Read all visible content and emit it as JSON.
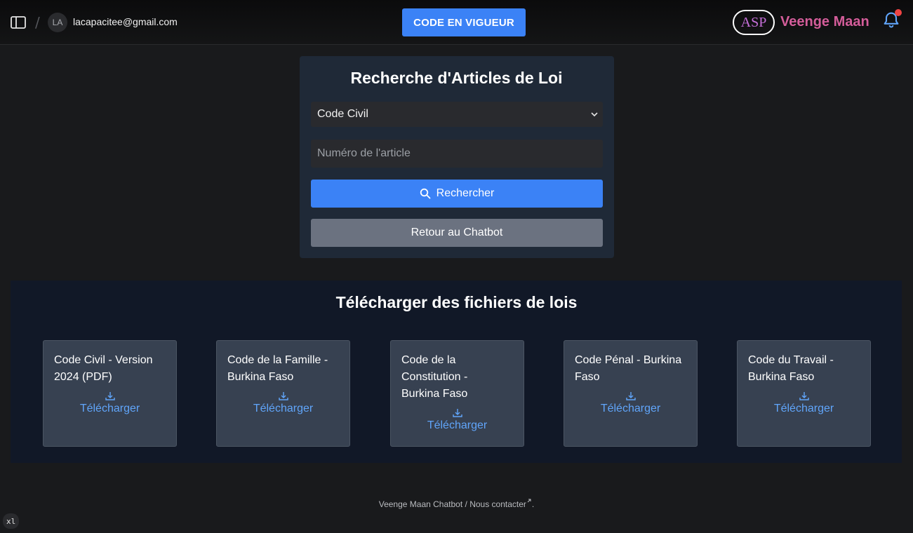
{
  "header": {
    "avatar_initials": "LA",
    "user_email": "lacapacitee@gmail.com",
    "code_button": "CODE EN VIGUEUR",
    "logo_text": "ASP",
    "brand_name": "Veenge Maan"
  },
  "search": {
    "title": "Recherche d'Articles de Loi",
    "selected_code": "Code Civil",
    "article_placeholder": "Numéro de l'article",
    "search_button": "Rechercher",
    "back_button": "Retour au Chatbot"
  },
  "downloads": {
    "title": "Télécharger des fichiers de lois",
    "files": [
      {
        "title": "Code Civil - Version 2024 (PDF)",
        "action": "Télécharger"
      },
      {
        "title": "Code de la Famille - Burkina Faso",
        "action": "Télécharger"
      },
      {
        "title": "Code de la Constitution - Burkina Faso",
        "action": "Télécharger"
      },
      {
        "title": "Code Pénal - Burkina Faso",
        "action": "Télécharger"
      },
      {
        "title": "Code du Travail - Burkina Faso",
        "action": "Télécharger"
      }
    ]
  },
  "footer": {
    "app_name": "Veenge Maan Chatbot",
    "separator": "/",
    "contact_link": "Nous contacter",
    "period": "."
  },
  "badge": "xl",
  "colors": {
    "primary": "#3b82f6",
    "secondary": "#6b7280",
    "link": "#60a5fa",
    "brand": "#d45d9a",
    "notification": "#ef4444"
  }
}
